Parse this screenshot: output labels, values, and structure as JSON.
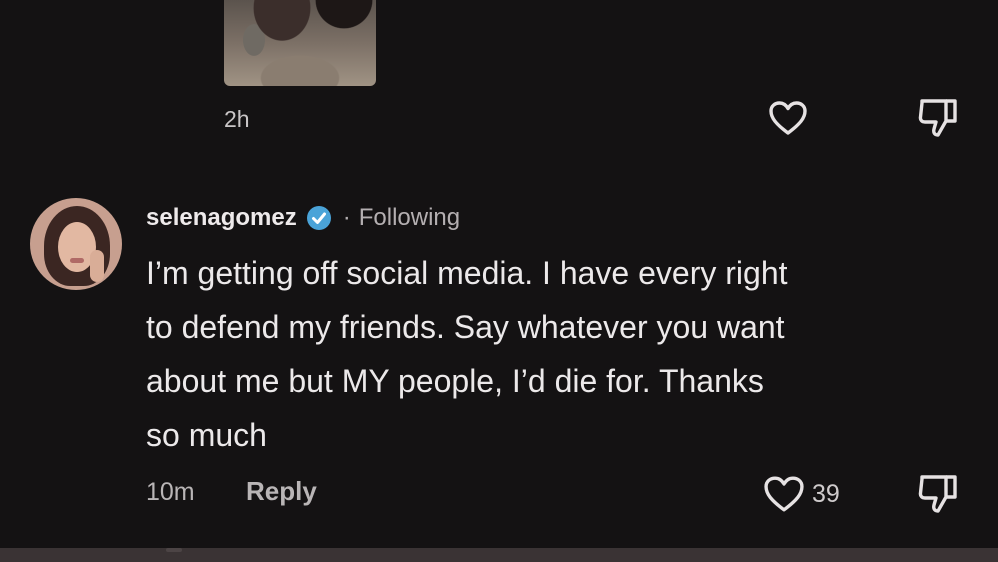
{
  "previous_comment": {
    "time": "2h",
    "icons": {
      "like": "heart-outline-icon",
      "dislike": "thumbs-down-icon"
    }
  },
  "comment": {
    "username": "selenagomez",
    "separator": "·",
    "follow_status": "Following",
    "text": "I’m getting off social media. I have every right\nto defend my friends. Say whatever you want\nabout me but MY people, I’d die for. Thanks\nso much",
    "time": "10m",
    "reply_label": "Reply",
    "like_count": "39",
    "icons": {
      "verified": "verified-badge-icon",
      "like": "heart-outline-icon",
      "dislike": "thumbs-down-icon"
    }
  },
  "colors": {
    "background": "#141213",
    "text": "#ece9ea",
    "muted": "#b9b5b6",
    "verified": "#4aa3d8"
  }
}
